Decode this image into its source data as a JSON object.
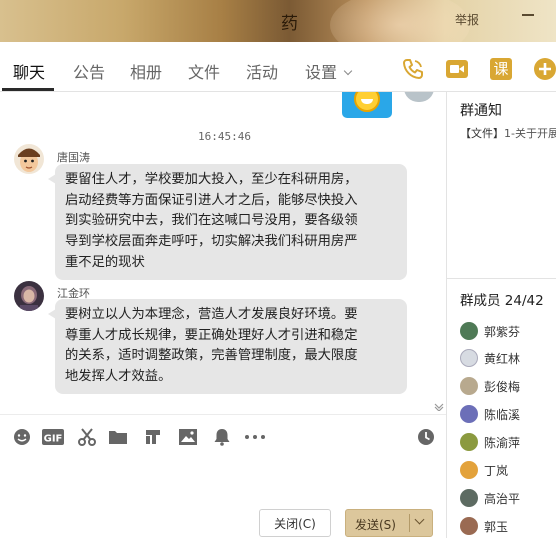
{
  "window": {
    "title": "药",
    "report_label": "举报",
    "accent": "#d9a733"
  },
  "tabs": [
    {
      "label": "聊天",
      "active": true
    },
    {
      "label": "公告"
    },
    {
      "label": "相册"
    },
    {
      "label": "文件"
    },
    {
      "label": "活动"
    },
    {
      "label": "设置"
    }
  ],
  "header_actions": {
    "phone": "phone-icon",
    "video": "video-icon",
    "class_label": "课",
    "more": "add-icon"
  },
  "chat": {
    "timestamp": "16:45:46",
    "messages": [
      {
        "sender": "唐国涛",
        "lines": [
          "要留住人才，学校要加大投入，至少在科研用房，",
          "启动经费等方面保证引进人才之后，能够尽快投入",
          "到实验研究中去，我们在这喊口号没用，要各级领",
          "导到学校层面奔走呼吁，切实解决我们科研用房严",
          "重不足的现状"
        ]
      },
      {
        "sender": "江金环",
        "lines": [
          "要树立以人为本理念，营造人才发展良好环境。要",
          "尊重人才成长规律，要正确处理好人才引进和稳定",
          "的关系，适时调整政策，完善管理制度，最大限度",
          "地发挥人才效益。"
        ]
      }
    ]
  },
  "toolbar": {
    "gif_label": "GIF",
    "icons": [
      "emoji-icon",
      "gif-icon",
      "scissors-icon",
      "folder-icon",
      "music-icon",
      "image-icon",
      "bell-icon",
      "more-icon",
      "history-icon"
    ]
  },
  "buttons": {
    "close_label": "关闭(C)",
    "send_label": "发送(S)"
  },
  "sidebar": {
    "notice_title": "群通知",
    "notice_tag": "【文件】",
    "notice_text": "1-关于开展",
    "members_title": "群成员 24/42",
    "members": [
      "郭紫芬",
      "黄红林",
      "彭俊梅",
      "陈临溪",
      "陈渝萍",
      "丁岚",
      "高治平",
      "郭玉"
    ]
  }
}
